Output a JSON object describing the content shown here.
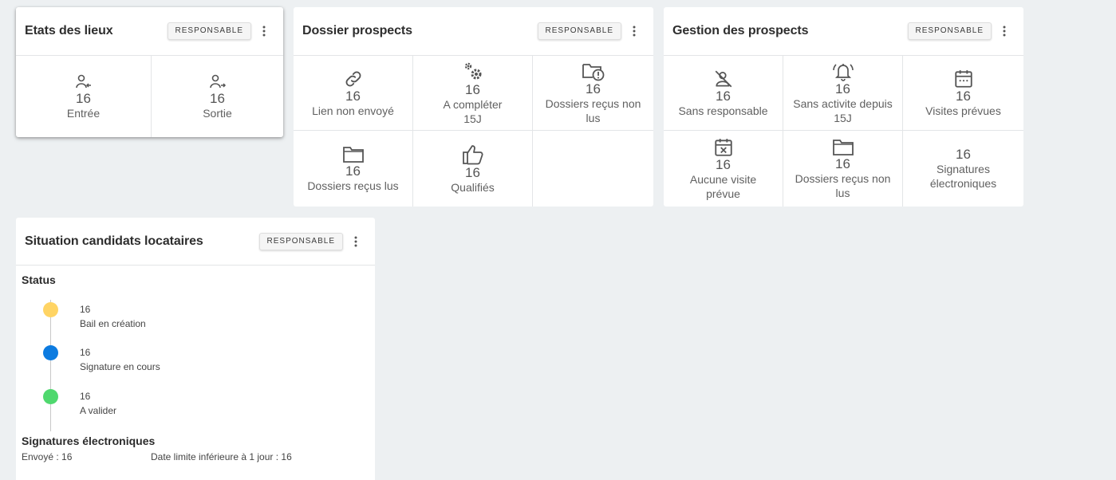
{
  "colors": {
    "status_creation": "#ffd464",
    "status_signature": "#0c7be0",
    "status_valider": "#4fd86e"
  },
  "etats": {
    "title": "Etats des lieux",
    "button": "RESPONSABLE",
    "cells": [
      {
        "icon": "person-arrow-in-icon",
        "value": "16",
        "label": "Entrée"
      },
      {
        "icon": "person-arrow-out-icon",
        "value": "16",
        "label": "Sortie"
      }
    ]
  },
  "dossier": {
    "title": "Dossier prospects",
    "button": "RESPONSABLE",
    "cells": [
      {
        "icon": "link-icon",
        "value": "16",
        "label": "Lien non envoyé"
      },
      {
        "icon": "gears-icon",
        "value": "16",
        "label": "A compléter",
        "label2": "15J"
      },
      {
        "icon": "folder-alert-icon",
        "value": "16",
        "label": "Dossiers reçus non lus"
      },
      {
        "icon": "folder-icon",
        "value": "16",
        "label": "Dossiers reçus lus"
      },
      {
        "icon": "thumb-up-icon",
        "value": "16",
        "label": "Qualifiés"
      }
    ]
  },
  "gestion": {
    "title": "Gestion des prospects",
    "button": "RESPONSABLE",
    "cells": [
      {
        "icon": "person-off-icon",
        "value": "16",
        "label": "Sans responsable"
      },
      {
        "icon": "bell-ring-icon",
        "value": "16",
        "label": "Sans activite depuis",
        "label2": "15J"
      },
      {
        "icon": "calendar-icon",
        "value": "16",
        "label": "Visites prévues"
      },
      {
        "icon": "calendar-remove-icon",
        "value": "16",
        "label": "Aucune visite prévue"
      },
      {
        "icon": "folder-icon",
        "value": "16",
        "label": "Dossiers reçus non lus"
      },
      {
        "icon": "",
        "value": "16",
        "label": "Signatures électroniques"
      }
    ]
  },
  "situation": {
    "title": "Situation candidats locataires",
    "button": "RESPONSABLE",
    "status_title": "Status",
    "statuses": [
      {
        "value": "16",
        "label": "Bail en création"
      },
      {
        "value": "16",
        "label": "Signature en cours"
      },
      {
        "value": "16",
        "label": "A valider"
      }
    ],
    "signatures_title": "Signatures électroniques",
    "envoye": "Envoyé : 16",
    "date_limite": "Date limite inférieure à 1 jour : 16"
  }
}
